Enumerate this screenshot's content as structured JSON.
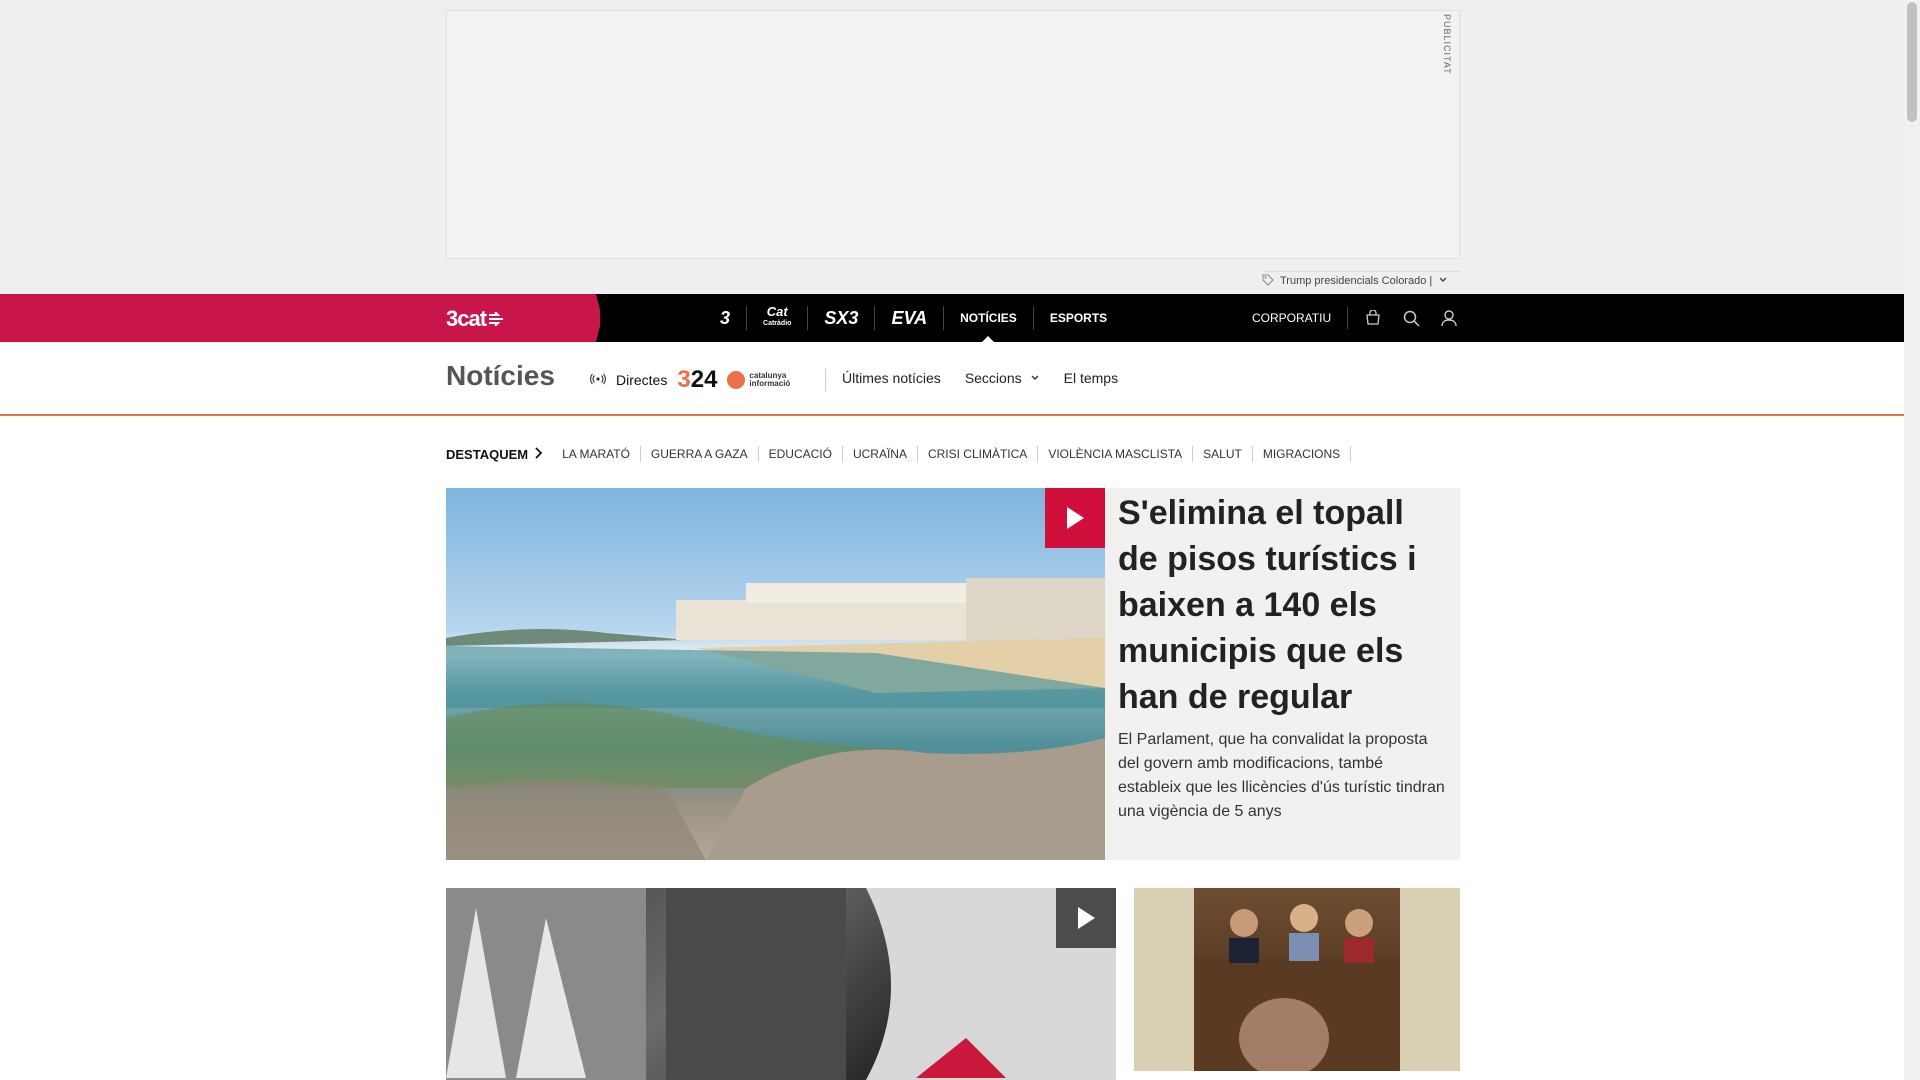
{
  "ad": {
    "label": "PUBLICITAT"
  },
  "trending": {
    "text": "Trump presidencials Colorado |"
  },
  "nav": {
    "logo": "3cat",
    "channels": [
      {
        "label": "3"
      },
      {
        "label": "Cat",
        "sub": "Catràdio"
      },
      {
        "label": "SX3"
      },
      {
        "label": "EVA"
      }
    ],
    "links": [
      "NOTÍCIES",
      "ESPORTS"
    ],
    "corporate": "CORPORATIU"
  },
  "section": {
    "title": "Notícies",
    "directes": "Directes",
    "logo_324_prefix": "3",
    "logo_324_suffix": "24",
    "catinf_line1": "catalunya",
    "catinf_line2": "informació",
    "links": [
      "Últimes notícies",
      "Seccions",
      "El temps"
    ]
  },
  "highlights": {
    "label": "DESTAQUEM",
    "tags": [
      "LA MARATÓ",
      "GUERRA A GAZA",
      "EDUCACIÓ",
      "UCRAÏNA",
      "CRISI CLIMÀTICA",
      "VIOLÈNCIA MASCLISTA",
      "SALUT",
      "MIGRACIONS"
    ]
  },
  "hero": {
    "title": "S'elimina el topall de pisos turístics i baixen a 140 els municipis que els han de regular",
    "summary": "El Parlament, que ha convalidat la proposta del govern amb modificacions, també estableix que les llicències d'ús turístic tindran una vigència de 5 anys"
  },
  "colors": {
    "brand_red": "#c8164a",
    "play_red": "#d0103a",
    "accent_orange": "#e8734a"
  }
}
